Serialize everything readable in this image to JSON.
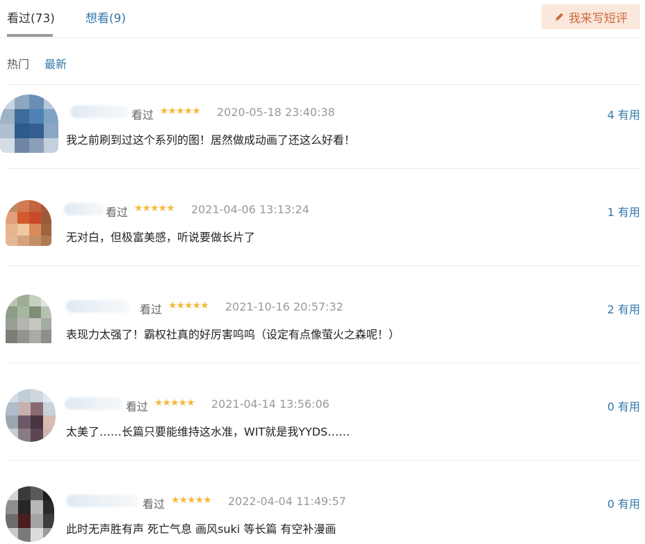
{
  "tabs": [
    {
      "label": "看过(73)"
    },
    {
      "label": "想看(9)"
    }
  ],
  "write_button": {
    "label": "我来写短评",
    "icon": "pencil-icon"
  },
  "sort": {
    "hot": "热门",
    "new": "最新"
  },
  "comments": [
    {
      "watched": "看过",
      "stars": "★★★★★",
      "rating": 5,
      "time": "2020-05-18 23:40:38",
      "useful": "4 有用",
      "text": "我之前刷到过这个系列的图！居然做成动画了还这么好看！"
    },
    {
      "watched": "看过",
      "stars": "★★★★★",
      "rating": 5,
      "time": "2021-04-06 13:13:24",
      "useful": "1 有用",
      "text": "无对白，但极富美感，听说要做长片了"
    },
    {
      "watched": "看过",
      "stars": "★★★★★",
      "rating": 5,
      "time": "2021-10-16 20:57:32",
      "useful": "2 有用",
      "text": "表现力太强了！霸权社真的好厉害呜呜（设定有点像萤火之森呢！）"
    },
    {
      "watched": "看过",
      "stars": "★★★★★",
      "rating": 5,
      "time": "2021-04-14 13:56:06",
      "useful": "0 有用",
      "text": "太美了……长篇只要能维持这水准，WIT就是我YYDS……"
    },
    {
      "watched": "看过",
      "stars": "★★★★★",
      "rating": 5,
      "time": "2022-04-04 11:49:57",
      "useful": "0 有用",
      "text": "此时无声胜有声 死亡气息 画风suki 等长篇 有空补漫画"
    }
  ]
}
